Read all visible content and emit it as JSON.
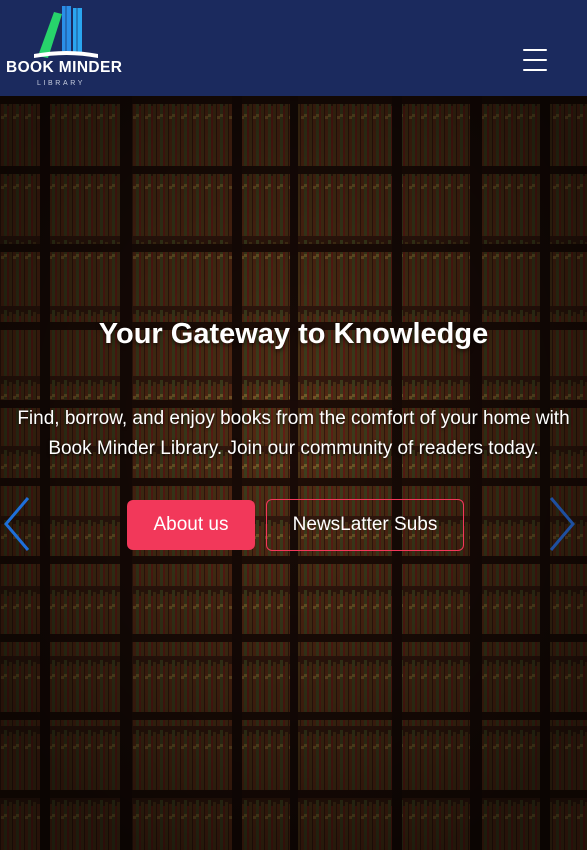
{
  "navbar": {
    "logo_title": "BOOK MINDER",
    "logo_subtitle": "LIBRARY",
    "menu_icon": "hamburger-icon",
    "background_color": "#1b2a5e"
  },
  "hero": {
    "title": "Your Gateway to Knowledge",
    "text": "Find, borrow, and enjoy books from the comfort of your home with Book Minder Library. Join our community of readers today.",
    "primary_button": "About us",
    "secondary_button": "NewsLatter Subs",
    "prev_icon": "chevron-left-icon",
    "next_icon": "chevron-right-icon",
    "accent_color": "#f2385a",
    "arrow_color": "#1e6fd9"
  }
}
